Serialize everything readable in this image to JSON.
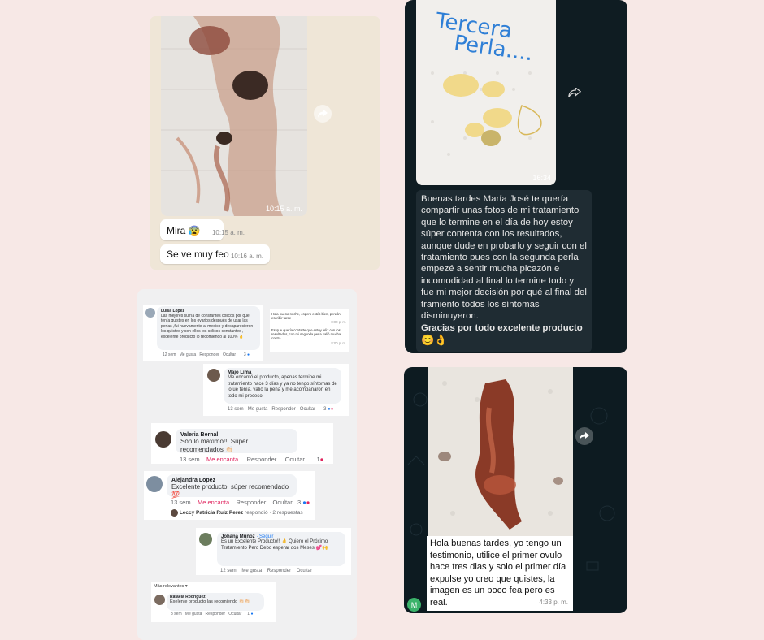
{
  "wa1": {
    "photo_time": "10:15 a. m.",
    "messages": [
      {
        "text": "Mira",
        "emoji": "😰",
        "time": "10:15 a. m."
      },
      {
        "text": "Se ve muy feo",
        "time": "10:16 a. m."
      }
    ]
  },
  "wa2": {
    "photo_caption_line1": "Tercera",
    "photo_caption_line2": "Perla....",
    "photo_time": "16:34",
    "message": "Buenas tardes María José te quería compartir unas fotos de mi tratamiento que lo termine en el día de hoy estoy súper contenta con los resultados, aunque dude en probarlo y seguir con el tratamiento pues con la segunda perla empezé a sentir mucha picazón e incomodidad al final lo termine todo y fue mi mejor decisión por qué al final del tramiento todos los síntomas disminuyeron.",
    "message_bold": "Gracias por todo excelente producto"
  },
  "wa3": {
    "message": "Hola buenas tardes, yo tengo un testimonio, utilice el primer ovulo hace tres dias y solo el primer día expulse yo creo que quistes, la imagen es un poco fea pero es real.",
    "time": "4:33 p. m.",
    "avatar_letter": "M"
  },
  "fb": {
    "c1": {
      "name": "Luisa Lopez",
      "text": "Las mejores sufría de constantes cólicos por qué tenía quistes en los ovarios después de usar las perlas ,fui nuevamente al medico y desaparecieron los quistes y con ellos los cólicos constantes , excelente producto lo recomiendo al 100% 👌",
      "time": "12 sem",
      "like": "Me gusta",
      "reply": "Responder",
      "hide": "Ocultar",
      "count": "3"
    },
    "chat_side": {
      "msg1": "Hola buena noche, espero estés bien, perdón escribir tarde",
      "time1": "8:00 p. m.",
      "msg2": "Es que quería contarte que estoy feliz con los resultados, con mi segunda perla salió mucha costra",
      "time2": "8:00 p. m."
    },
    "c2": {
      "name": "Majo Lima",
      "text": "Me encantó el producto, apenas termine mi tratamiento hace 3 días y ya no tengo síntomas de lo ue tenía, valió la pena y me acompañaron en todo mi proceso",
      "time": "13 sem",
      "like": "Me gusta",
      "reply": "Responder",
      "hide": "Ocultar",
      "count": "3"
    },
    "c3": {
      "name": "Valeria Bernal",
      "text": "Son lo máximo!!! Súper recomendados 👏🏻",
      "time": "13 sem",
      "like": "Me encanta",
      "reply": "Responder",
      "hide": "Ocultar",
      "count": "1"
    },
    "c4": {
      "name": "Alejandra Lopez",
      "text": "Excelente producto, súper recomendado 💯",
      "time": "13 sem",
      "like": "Me encanta",
      "reply": "Responder",
      "hide": "Ocultar",
      "count": "3",
      "reply_line_name": "Leccy Patricia Ruiz Perez",
      "reply_line_text": "respondió · 2 respuestas"
    },
    "c5": {
      "name": "Johana Muñoz",
      "follow": "· Seguir",
      "text": "Es un Excelente Producto!! 👌 Quiero el Próximo Tratamiento Pero Debo esperar dos Meses 💕🙌",
      "time": "12 sem",
      "like": "Me gusta",
      "reply": "Responder",
      "hide": "Ocultar"
    },
    "mas_relevantes": "Más relevantes",
    "c6": {
      "name": "Rafaela Rodriguez",
      "text": "Exelente producto las recomiendo 👏🏻👏🏻",
      "time": "3 sem",
      "like": "Me gusta",
      "reply": "Responder",
      "hide": "Ocultar",
      "count": "1"
    }
  },
  "colors": {
    "background": "#f7e8e6",
    "whatsapp_dark": "#0f1c22",
    "facebook_panel": "#f0f0f1",
    "love_red": "#e0245e"
  }
}
